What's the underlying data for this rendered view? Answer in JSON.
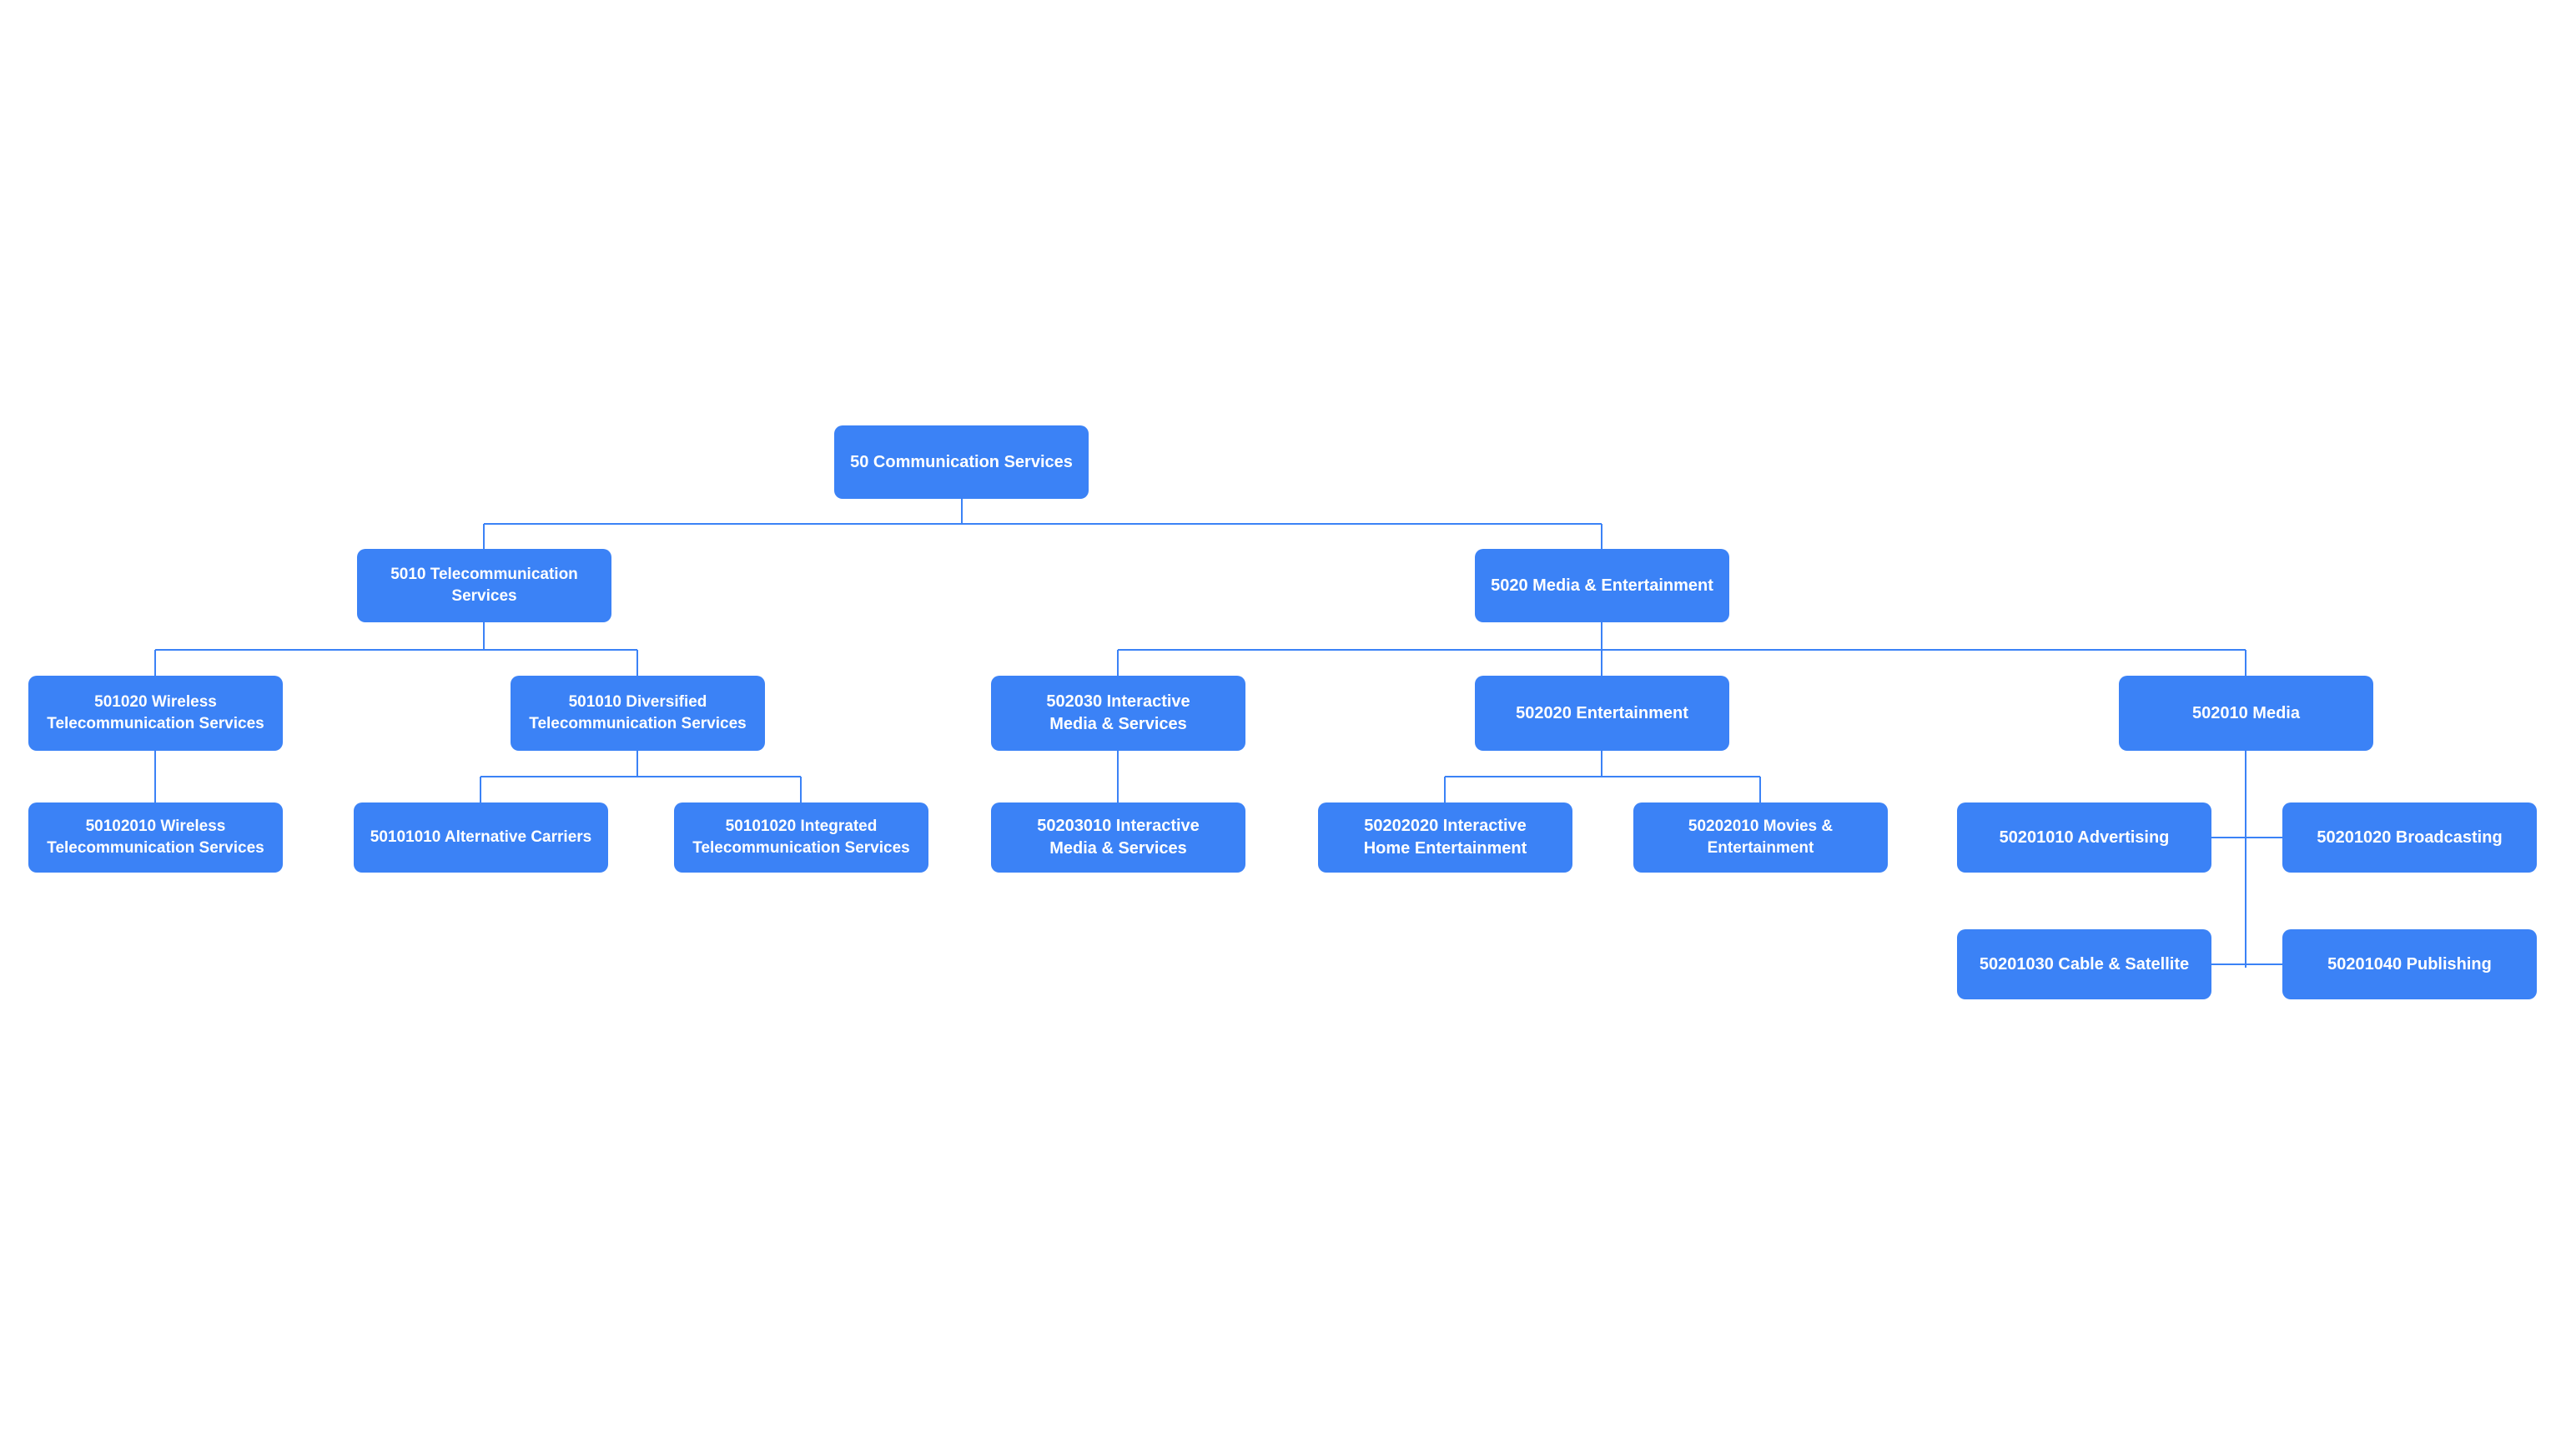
{
  "colors": {
    "node_fill": "#3b82f6",
    "node_text": "#ffffff",
    "connector": "#3b82f6"
  },
  "nodes": {
    "root": {
      "label": "50 Communication Services"
    },
    "l1a": {
      "label": "5010 Telecommunication Services"
    },
    "l1b": {
      "label": "5020 Media & Entertainment"
    },
    "l2a": {
      "label": "501020 Wireless\nTelecommunication Services"
    },
    "l2b": {
      "label": "501010 Diversified\nTelecommunication Services"
    },
    "l2c": {
      "label": "502030 Interactive\nMedia & Services"
    },
    "l2d": {
      "label": "502020 Entertainment"
    },
    "l2e": {
      "label": "502010 Media"
    },
    "l3a": {
      "label": "50102010 Wireless\nTelecommunication Services"
    },
    "l3b": {
      "label": "50101010 Alternative Carriers"
    },
    "l3c": {
      "label": "50101020 Integrated\nTelecommunication Services"
    },
    "l3d": {
      "label": "50203010 Interactive\nMedia & Services"
    },
    "l3e": {
      "label": "50202020 Interactive\nHome Entertainment"
    },
    "l3f": {
      "label": "50202010 Movies & Entertainment"
    },
    "l3g": {
      "label": "50201010 Advertising"
    },
    "l3h": {
      "label": "50201020 Broadcasting"
    },
    "l3i": {
      "label": "50201030 Cable & Satellite"
    },
    "l3j": {
      "label": "50201040 Publishing"
    }
  }
}
